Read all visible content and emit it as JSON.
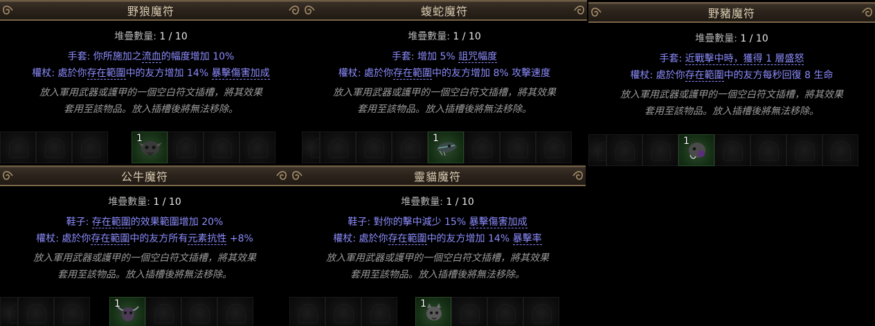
{
  "panels": [
    {
      "title": "野狼魔符",
      "stack_label": "堆疊數量: ",
      "stack_value": "1 / 10",
      "mods": [
        {
          "pre": "手套: 你所施加之",
          "kw": "流血",
          "post": "的幅度增加 10%"
        },
        {
          "pre": "權杖: 處於你",
          "kw": "存在範圍",
          "mid": "中的友方增加 14% ",
          "kw2": "暴擊傷害加成"
        }
      ],
      "flavor": [
        "放入軍用武器或護甲的一個空白符文插槽，將其效果",
        "套用至該物品。放入插槽後將無法移除。"
      ],
      "item_qty": "1",
      "item_icon": "wolf-skull-icon"
    },
    {
      "title": "蝮蛇魔符",
      "stack_label": "堆疊數量: ",
      "stack_value": "1 / 10",
      "mods": [
        {
          "pre": "手套: 增加 5% ",
          "kw": "詛咒幅度",
          "post": ""
        },
        {
          "pre": "權杖: 處於你",
          "kw": "存在範圍",
          "post": "中的友方增加 8% 攻擊速度"
        }
      ],
      "flavor": [
        "放入軍用武器或護甲的一個空白符文插槽，將其效果",
        "套用至該物品。放入插槽後將無法移除。"
      ],
      "item_qty": "1",
      "item_icon": "serpent-skull-icon"
    },
    {
      "title": "野豬魔符",
      "stack_label": "堆疊數量: ",
      "stack_value": "1 / 10",
      "mods": [
        {
          "pre": "手套: ",
          "kw": "近戰擊中時，獲得 1 層盛怒",
          "post": ""
        },
        {
          "pre": "權杖: 處於你",
          "kw": "存在範圍",
          "post": "中的友方每秒回復 8 生命"
        }
      ],
      "flavor": [
        "放入軍用武器或護甲的一個空白符文插槽，將其效果",
        "套用至該物品。放入插槽後將無法移除。"
      ],
      "item_qty": "1",
      "item_icon": "boar-skull-icon"
    },
    {
      "title": "公牛魔符",
      "stack_label": "堆疊數量: ",
      "stack_value": "1 / 10",
      "mods": [
        {
          "pre": "鞋子: ",
          "kw": "存在範圍",
          "post": "的效果範圍增加 20%"
        },
        {
          "pre": "權杖: 處於你",
          "kw": "存在範圍",
          "mid": "中的友方所有",
          "kw2": "元素抗性",
          "post2": " +8%"
        }
      ],
      "flavor": [
        "放入軍用武器或護甲的一個空白符文插槽，將其效果",
        "套用至該物品。放入插槽後將無法移除。"
      ],
      "item_qty": "1",
      "item_icon": "bull-skull-icon"
    },
    {
      "title": "靈貓魔符",
      "stack_label": "堆疊數量: ",
      "stack_value": "1 / 10",
      "mods": [
        {
          "pre": "鞋子: 對你的擊中減少 15% ",
          "kw": "暴擊傷害加成",
          "post": ""
        },
        {
          "pre": "權杖: 處於你",
          "kw": "存在範圍",
          "mid": "中的友方增加 14% ",
          "kw2": "暴擊率"
        }
      ],
      "flavor": [
        "放入軍用武器或護甲的一個空白符文插槽，將其效果",
        "套用至該物品。放入插槽後將無法移除。"
      ],
      "item_qty": "1",
      "item_icon": "cat-skull-icon"
    }
  ],
  "colors": {
    "title": "#d9cbb1",
    "mod": "#8c8cff",
    "flavor": "#9a9a9a",
    "stack_label": "#b4b4b4",
    "stack_value": "#e6e6e6"
  }
}
